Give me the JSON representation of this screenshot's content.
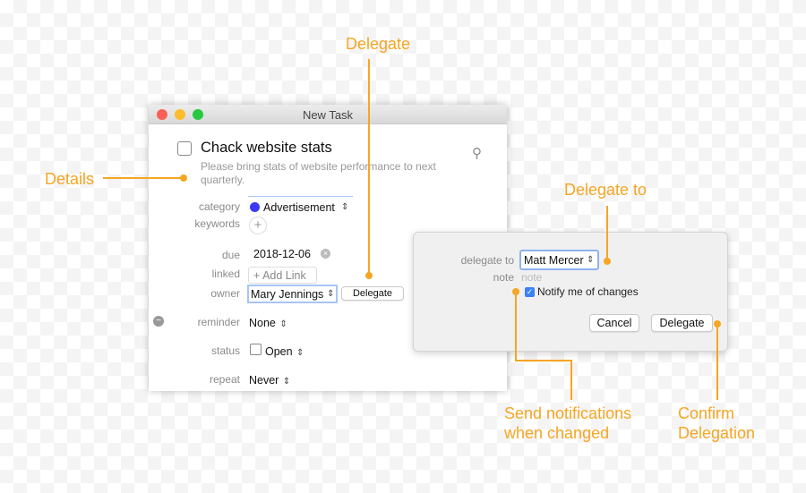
{
  "window": {
    "title": "New Task"
  },
  "task": {
    "title": "Chack website stats",
    "description": "Please bring stats of website performance to next quarterly.",
    "category_label": "category",
    "category_value": "Advertisement",
    "category_color": "#3a3af5",
    "keywords_label": "keywords",
    "due_label": "due",
    "due_value": "2018-12-06",
    "linked_label": "linked",
    "add_link": "+ Add Link",
    "owner_label": "owner",
    "owner_value": "Mary Jennings",
    "delegate_button": "Delegate",
    "reminder_label": "reminder",
    "reminder_value": "None",
    "status_label": "status",
    "status_value": "Open",
    "repeat_label": "repeat",
    "repeat_value": "Never"
  },
  "popover": {
    "delegate_to_label": "delegate to",
    "delegate_to_value": "Matt Mercer",
    "note_label": "note",
    "note_placeholder": "note",
    "notify_label": "Notify me of changes",
    "notify_checked": true,
    "cancel": "Cancel",
    "delegate": "Delegate"
  },
  "annotations": {
    "delegate": "Delegate",
    "details": "Details",
    "delegate_to": "Delegate to",
    "send_notifications": [
      "Send notifications",
      "when changed"
    ],
    "confirm": [
      "Confirm",
      "Delegation"
    ],
    "color": "#f5a623"
  }
}
